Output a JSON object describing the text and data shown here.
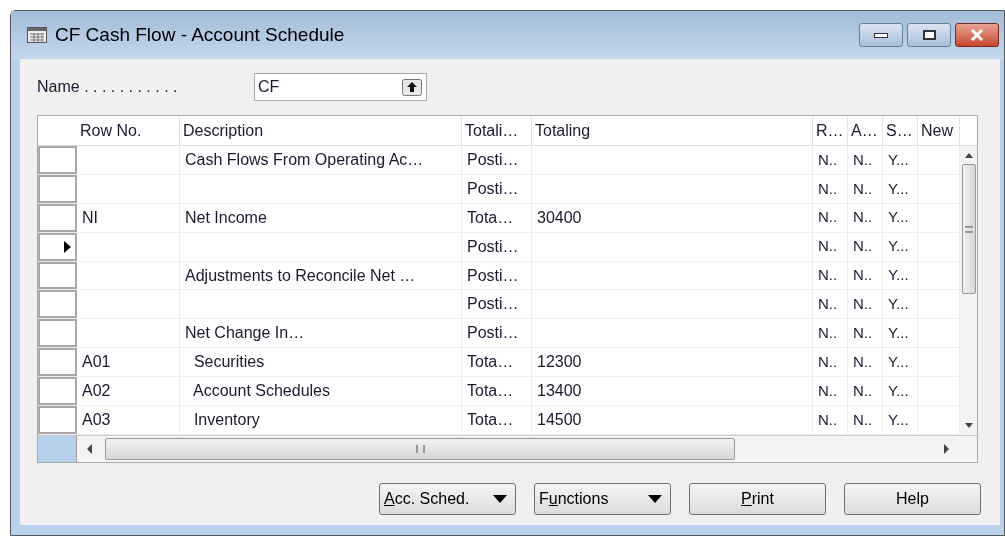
{
  "window": {
    "title": "CF Cash Flow - Account Schedule"
  },
  "name_field": {
    "label": "Name . . . . . . . . . . .",
    "value": "CF"
  },
  "table": {
    "columns": [
      "Row No.",
      "Description",
      "Totali…",
      "Totaling",
      "R…",
      "A…",
      "S…",
      "New"
    ],
    "rows": [
      {
        "selected": false,
        "cells": [
          null,
          "Cash Flows From Operating Ac…",
          "Posti…",
          null,
          "N..",
          "N..",
          "Y...",
          null
        ]
      },
      {
        "selected": false,
        "cells": [
          null,
          null,
          "Posti…",
          null,
          "N..",
          "N..",
          "Y...",
          null
        ]
      },
      {
        "selected": false,
        "cells": [
          "NI",
          "Net Income",
          "Tota…",
          "30400",
          "N..",
          "N..",
          "Y...",
          null
        ]
      },
      {
        "selected": true,
        "cells": [
          null,
          null,
          "Posti…",
          null,
          "N..",
          "N..",
          "Y...",
          null
        ]
      },
      {
        "selected": false,
        "cells": [
          null,
          "Adjustments to Reconcile Net …",
          "Posti…",
          null,
          "N..",
          "N..",
          "Y...",
          null
        ]
      },
      {
        "selected": false,
        "cells": [
          null,
          null,
          "Posti…",
          null,
          "N..",
          "N..",
          "Y...",
          null
        ]
      },
      {
        "selected": false,
        "cells": [
          null,
          "Net Change In…",
          "Posti…",
          null,
          "N..",
          "N..",
          "Y...",
          null
        ]
      },
      {
        "selected": false,
        "cells": [
          "A01",
          "  Securities",
          "Tota…",
          "12300",
          "N..",
          "N..",
          "Y...",
          null
        ]
      },
      {
        "selected": false,
        "cells": [
          "A02",
          "  Account Schedules",
          "Tota…",
          "13400",
          "N..",
          "N..",
          "Y...",
          null
        ]
      },
      {
        "selected": false,
        "cells": [
          "A03",
          "  Inventory",
          "Tota…",
          "14500",
          "N..",
          "N..",
          "Y...",
          null
        ]
      }
    ]
  },
  "buttons": [
    {
      "kind": "menu",
      "key": "A",
      "after": "cc. Sched."
    },
    {
      "kind": "menu",
      "before": "F",
      "key": "u",
      "after": "nctions"
    },
    {
      "kind": "plain",
      "key": "P",
      "after": "rint"
    },
    {
      "kind": "plain",
      "before": "Help"
    }
  ]
}
